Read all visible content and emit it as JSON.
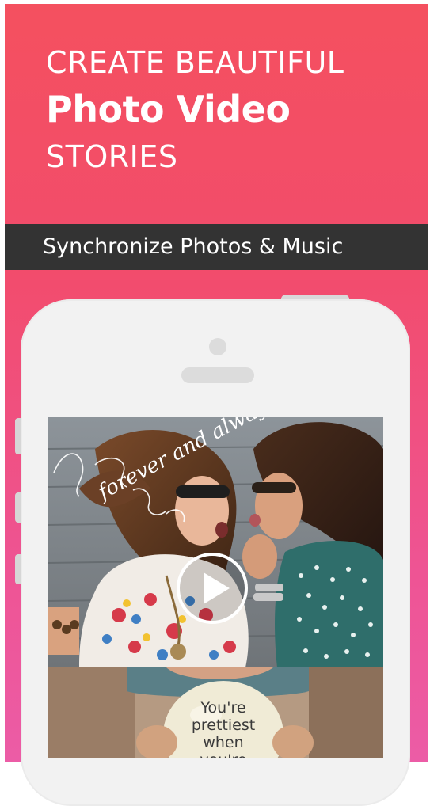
{
  "headline": {
    "line1": "CREATE BEAUTIFUL",
    "line2": "Photo Video",
    "line3": "STORIES"
  },
  "banner": {
    "text": "Synchronize Photos & Music"
  },
  "video": {
    "overlay_text": "forever and always",
    "play_icon": "play-icon"
  },
  "second_photo": {
    "sign_text": "You're prettiest when you're"
  },
  "colors": {
    "background_top": "#f4505f",
    "background_bottom": "#ec5ca6",
    "banner": "#333333",
    "phone_body": "#f2f2f2"
  }
}
